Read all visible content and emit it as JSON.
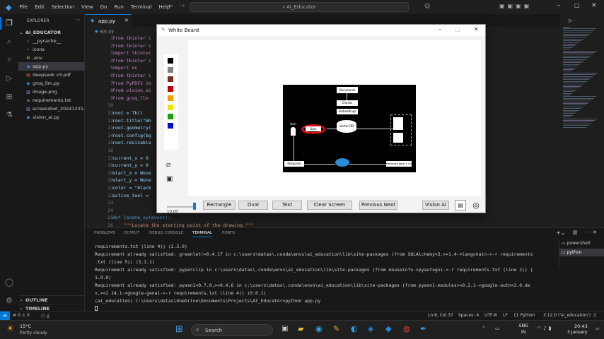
{
  "titlebar": {
    "menus": [
      "File",
      "Edit",
      "Selection",
      "View",
      "Go",
      "Run",
      "Terminal",
      "Help"
    ],
    "search": "AI_Educator"
  },
  "explorer": {
    "header": "EXPLORER",
    "root": "AI_EDUCATOR",
    "items": [
      {
        "name": "__pycache__",
        "kind": "folder"
      },
      {
        "name": "icons",
        "kind": "folder"
      },
      {
        "name": ".env",
        "kind": "env"
      },
      {
        "name": "app.py",
        "kind": "py"
      },
      {
        "name": "deepseek v3.pdf",
        "kind": "pdf"
      },
      {
        "name": "groq_llm.py",
        "kind": "py"
      },
      {
        "name": "image.png",
        "kind": "img"
      },
      {
        "name": "requirements.txt",
        "kind": "txt"
      },
      {
        "name": "screenshot_20241231...",
        "kind": "img"
      },
      {
        "name": "vision_ai.py",
        "kind": "py"
      }
    ],
    "outline": "OUTLINE",
    "timeline": "TIMELINE"
  },
  "editor": {
    "tab": "app.py",
    "breadcrumb": "app.py",
    "lines": [
      {
        "n": "1",
        "t": "from tkinter i"
      },
      {
        "n": "2",
        "t": "from tkinter i"
      },
      {
        "n": "3",
        "t": "import tkinter"
      },
      {
        "n": "4",
        "t": "from tkinter i"
      },
      {
        "n": "5",
        "t": "import os"
      },
      {
        "n": "6",
        "t": "from tkinter i"
      },
      {
        "n": "7",
        "t": "from PyPDF2 im"
      },
      {
        "n": "8",
        "t": "from vision_ai"
      },
      {
        "n": "9",
        "t": "from groq_llm"
      },
      {
        "n": "10",
        "t": ""
      },
      {
        "n": "11",
        "t": "root = Tk()"
      },
      {
        "n": "12",
        "t": "root.title(\"Wh"
      },
      {
        "n": "13",
        "t": "root.geometry("
      },
      {
        "n": "14",
        "t": "root.config(bg"
      },
      {
        "n": "15",
        "t": "root.resizable"
      },
      {
        "n": "16",
        "t": ""
      },
      {
        "n": "17",
        "t": "current_x = 0"
      },
      {
        "n": "18",
        "t": "current_y = 0"
      },
      {
        "n": "19",
        "t": "start_x = None"
      },
      {
        "n": "20",
        "t": "start_y = None"
      },
      {
        "n": "21",
        "t": "color = \"black"
      },
      {
        "n": "22",
        "t": "active_tool ="
      },
      {
        "n": "23",
        "t": ""
      },
      {
        "n": "24",
        "t": ""
      },
      {
        "n": "25",
        "t": "def locate_xy(event):"
      },
      {
        "n": "26",
        "t": "    \"\"\"Locate the starting point of the drawing.\"\"\""
      }
    ]
  },
  "whiteboard": {
    "title": "White Board",
    "colors": [
      "#000000",
      "#808080",
      "#7a2e1f",
      "#c00000",
      "#f5a000",
      "#f5e000",
      "#18a000",
      "#0010c8"
    ],
    "slider_value": "10.00",
    "buttons": {
      "rectangle": "Rectangle",
      "oval": "Oval",
      "text": "Text",
      "clear": "Clear Screen",
      "prevnext": "Previous Next",
      "vision": "Vision AI"
    },
    "diagram": {
      "documents": "Documents",
      "chunks": "Chunks",
      "embeddings": "Embeddings",
      "user_query": "User Query",
      "vector_db": "Vector DB",
      "user": "User",
      "response": "Response",
      "retrieved": "Retrieved data + Query"
    }
  },
  "panel": {
    "tabs": [
      "PROBLEMS",
      "OUTPUT",
      "DEBUG CONSOLE",
      "TERMINAL",
      "PORTS"
    ],
    "active_tab": "TERMINAL",
    "terminals": [
      "powershell",
      "python"
    ],
    "lines": [
      "requirements.txt (line 4)) (2.3.0)",
      "Requirement already satisfied: greenlet!=0.4.17 in c:\\users\\datas\\.conda\\envs\\ai_education\\lib\\site-packages (from SQLAlchemy<3,>=1.4->langchain->-r requirements",
      ".txt (line 5)) (3.1.1)",
      "Requirement already satisfied: pyperclip in c:\\users\\datas\\.conda\\envs\\ai_education\\lib\\site-packages (from mouseinfo->pyautogui->-r requirements.txt (line 2)) (",
      "1.9.0)",
      "Requirement already satisfied: pyasn1<0.7.0,>=0.4.6 in c:\\users\\datas\\.conda\\envs\\ai_education\\lib\\site-packages (from pyasn1-modules>=0.2.1->google-auth<3.0.de",
      "v,>=2.14.1->google-genai->-r requirements.txt (line 4)) (0.6.1)",
      "",
      "(ai_education) C:\\Users\\datas\\OneDrive\\Documents\\Projects\\AI_Educator>python app.py"
    ]
  },
  "statusbar": {
    "errors": "0",
    "warnings": "0",
    "info": "0",
    "position": "Ln 8, Col 37",
    "spaces": "Spaces: 4",
    "encoding": "UTF-8",
    "eol": "LF",
    "language": "Python",
    "interpreter": "3.12.0 ('ai_education')"
  },
  "taskbar": {
    "temp": "15°C",
    "weather": "Partly cloudy",
    "search": "Search",
    "lang1": "ENG",
    "lang2": "IN",
    "time": "20:43",
    "date": "3 January"
  }
}
